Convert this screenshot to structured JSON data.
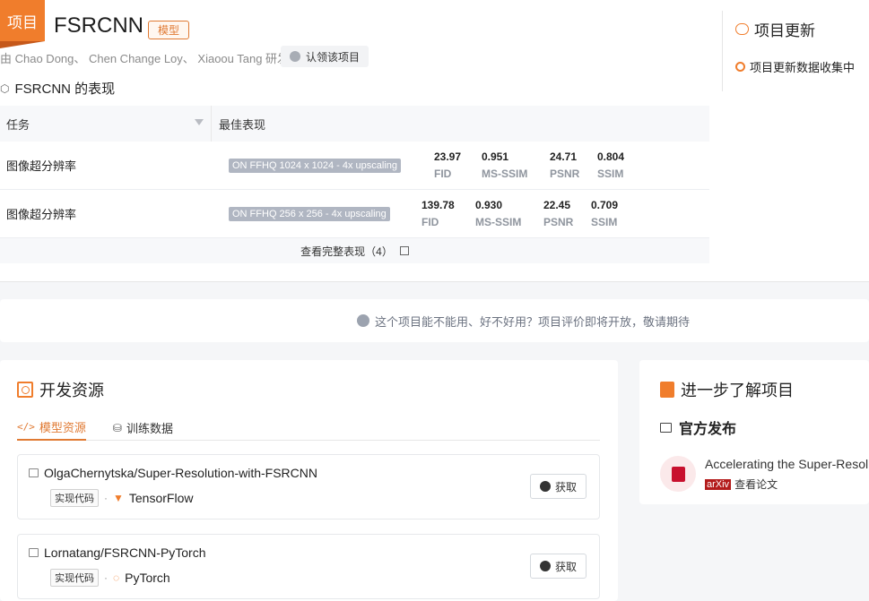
{
  "header": {
    "tag": "项目",
    "title": "FSRCNN",
    "badge": "模型",
    "authors": "由 Chao Dong、 Chen Change Loy、 Xiaoou Tang 研发",
    "claim_label": "认领该项目"
  },
  "performance": {
    "title": "FSRCNN 的表现",
    "columns": [
      "任务",
      "最佳表现"
    ],
    "rows": [
      {
        "task": "图像超分辨率",
        "dataset": "ON FFHQ 1024 x 1024 - 4x upscaling",
        "metrics": [
          {
            "value": "23.97",
            "name": "FID"
          },
          {
            "value": "0.951",
            "name": "MS-SSIM"
          },
          {
            "value": "24.71",
            "name": "PSNR"
          },
          {
            "value": "0.804",
            "name": "SSIM"
          }
        ]
      },
      {
        "task": "图像超分辨率",
        "dataset": "ON FFHQ 256 x 256 - 4x upscaling",
        "metrics": [
          {
            "value": "139.78",
            "name": "FID"
          },
          {
            "value": "0.930",
            "name": "MS-SSIM"
          },
          {
            "value": "22.45",
            "name": "PSNR"
          },
          {
            "value": "0.709",
            "name": "SSIM"
          }
        ]
      }
    ],
    "more_label": "查看完整表现（4）"
  },
  "updates": {
    "title": "项目更新",
    "item": "项目更新数据收集中"
  },
  "evaluation": {
    "text": "这个项目能不能用、好不好用？项目评价即将开放，敬请期待"
  },
  "resources": {
    "title": "开发资源",
    "tabs": [
      {
        "label": "模型资源",
        "active": true
      },
      {
        "label": "训练数据",
        "active": false
      }
    ],
    "repos": [
      {
        "name": "OlgaChernytska/Super-Resolution-with-FSRCNN",
        "impl": "实现代码",
        "framework": "TensorFlow",
        "get_label": "获取"
      },
      {
        "name": "Lornatang/FSRCNN-PyTorch",
        "impl": "实现代码",
        "framework": "PyTorch",
        "get_label": "获取"
      }
    ]
  },
  "learn": {
    "title": "进一步了解项目",
    "official_label": "官方发布",
    "paper_title": "Accelerating the Super-Resolution Convolutional Neural Network",
    "paper_source": "arXiv",
    "paper_link": "查看论文"
  },
  "colors": {
    "accent": "#f07d2c",
    "arxiv": "#b31b1b",
    "dataset_tag": "#b0b6c2"
  }
}
